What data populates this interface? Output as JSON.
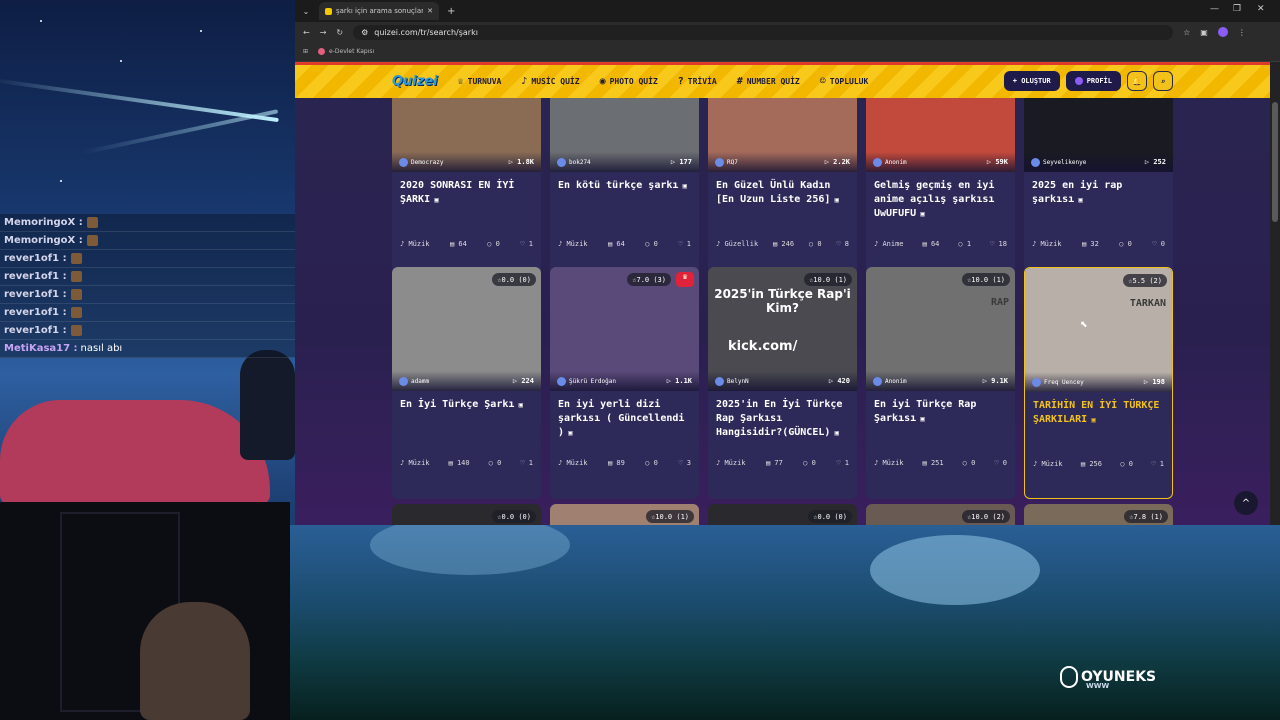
{
  "colors": {
    "accent": "#f3c21a",
    "brand": "#2a9ad8",
    "card": "#2d2a5a"
  },
  "chat": [
    {
      "name": "MemoringoX :",
      "msg": ""
    },
    {
      "name": "MemoringoX :",
      "msg": ""
    },
    {
      "name": "rever1of1 :",
      "msg": ""
    },
    {
      "name": "rever1of1 :",
      "msg": ""
    },
    {
      "name": "rever1of1 :",
      "msg": ""
    },
    {
      "name": "rever1of1 :",
      "msg": ""
    },
    {
      "name": "rever1of1 :",
      "msg": ""
    },
    {
      "name": "MetiKasa17 :",
      "msg": "nasıl abı"
    }
  ],
  "overlay_logo": {
    "text": "OYUNEKS",
    "sub": "WWW"
  },
  "browser": {
    "tab_title": "şarkı için arama sonuçları - Quizei",
    "url": "quizei.com/tr/search/şarkı",
    "bookmark": "e-Devlet Kapısı"
  },
  "nav": {
    "brand": "Quizei",
    "items": [
      {
        "label": "TURNUVA",
        "icon": "trophy-icon"
      },
      {
        "label": "MUSİC QUİZ",
        "icon": "music-icon"
      },
      {
        "label": "PHOTO QUİZ",
        "icon": "camera-icon"
      },
      {
        "label": "TRİVİA",
        "icon": "question-icon"
      },
      {
        "label": "NUMBER QUİZ",
        "icon": "hash-icon"
      },
      {
        "label": "TOPLULUK",
        "icon": "community-icon"
      }
    ],
    "create_label": "+ OLUŞTUR",
    "profile_label": "PROFİL"
  },
  "cards": [
    {
      "author": "Democrazy",
      "plays": "1.8K",
      "rating": "",
      "title": "2020 SONRASI EN İYİ ŞARKI",
      "cat": "Müzik",
      "q": "64",
      "c": "0",
      "l": "1",
      "thumb": "#8a6c55"
    },
    {
      "author": "bok274",
      "plays": "177",
      "rating": "",
      "title": "En kötü türkçe şarkı",
      "cat": "Müzik",
      "q": "64",
      "c": "0",
      "l": "1",
      "thumb": "#6b6e72"
    },
    {
      "author": "RQ7",
      "plays": "2.2K",
      "rating": "",
      "title": "En Güzel Ünlü Kadın [En Uzun Liste 256]",
      "cat": "Güzellik",
      "q": "246",
      "c": "0",
      "l": "8",
      "thumb": "#a46a5a"
    },
    {
      "author": "Anonim",
      "plays": "59K",
      "rating": "",
      "title": "Gelmiş geçmiş en iyi anime açılış şarkısı UwUFUFU",
      "cat": "Anime",
      "q": "64",
      "c": "1",
      "l": "18",
      "thumb": "#c24a3c"
    },
    {
      "author": "Seyvelikenye",
      "plays": "252",
      "rating": "",
      "title": "2025 en iyi rap şarkısı",
      "cat": "Müzik",
      "q": "32",
      "c": "0",
      "l": "0",
      "thumb": "#1a1a22"
    },
    {
      "author": "adamm",
      "plays": "224",
      "rating": "0.0 (0)",
      "title": "En İyi Türkçe Şarkı",
      "cat": "Müzik",
      "q": "140",
      "c": "0",
      "l": "1",
      "thumb": "#8c8c8c"
    },
    {
      "author": "Şükrü Erdoğan",
      "plays": "1.1K",
      "rating": "7.0 (3)",
      "title": "En iyi yerli dizi şarkısı ( Güncellendi )",
      "cat": "Müzik",
      "q": "89",
      "c": "0",
      "l": "3",
      "thumb": "#5a4a7a",
      "crown": true
    },
    {
      "author": "BelynN",
      "plays": "420",
      "rating": "10.0 (1)",
      "title": "2025'in En İyi Türkçe Rap Şarkısı Hangisidir?(GÜNCEL)",
      "cat": "Müzik",
      "q": "77",
      "c": "0",
      "l": "1",
      "thumb": "#4a4a50",
      "thumb_text1": "2025'in Türkçe Rap'i Kim?",
      "thumb_text2": "kick.com/"
    },
    {
      "author": "Anonim",
      "plays": "9.1K",
      "rating": "10.0 (1)",
      "title": "En iyi Türkçe Rap Şarkısı",
      "cat": "Müzik",
      "q": "251",
      "c": "0",
      "l": "0",
      "thumb": "#707070",
      "thumb_text3": "RAP"
    },
    {
      "author": "Freq Uencey",
      "plays": "198",
      "rating": "5.5 (2)",
      "title": "TARİHİN EN İYİ TÜRKÇE ŞARKILARI",
      "cat": "Müzik",
      "q": "256",
      "c": "0",
      "l": "1",
      "thumb": "#b8b0a8",
      "hl": true,
      "thumb_text3": "TARKAN"
    },
    {
      "rating": "0.0 (0)",
      "thumb": "#2a2a2e"
    },
    {
      "rating": "10.0 (1)",
      "thumb": "#a08070"
    },
    {
      "rating": "0.0 (0)",
      "thumb": "#2a2a2e"
    },
    {
      "rating": "10.0 (2)",
      "thumb": "#6a5a54"
    },
    {
      "rating": "7.8 (1)",
      "thumb": "#7a6a5a"
    }
  ]
}
